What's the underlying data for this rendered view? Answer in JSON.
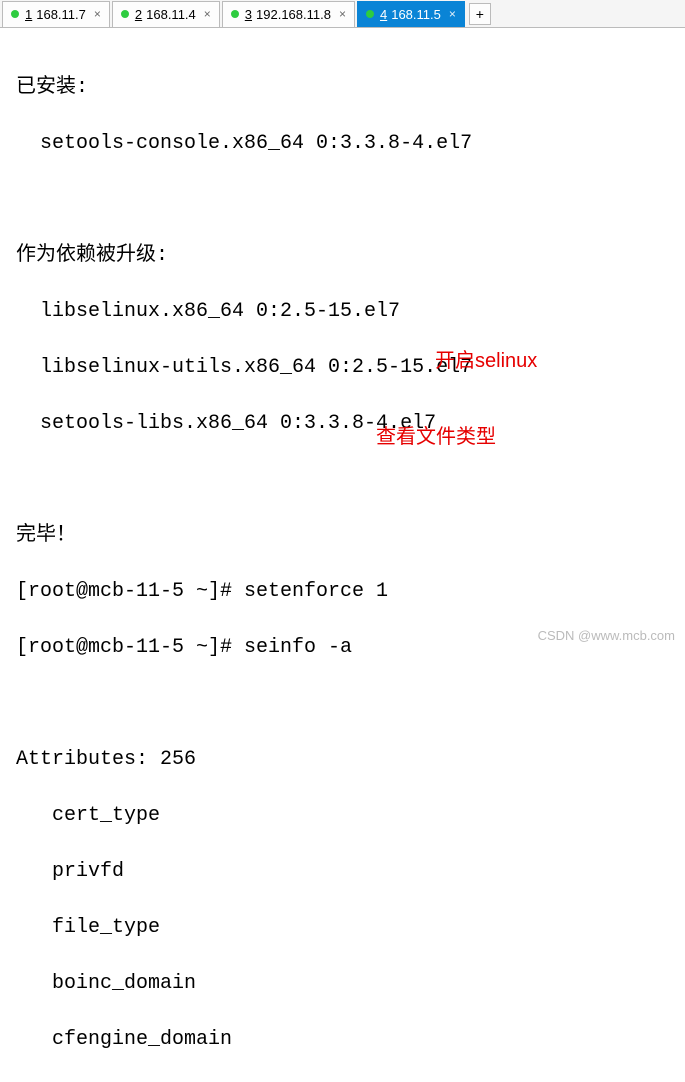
{
  "tabs": [
    {
      "num": "1",
      "label": "168.11.7",
      "active": false
    },
    {
      "num": "2",
      "label": "168.11.4",
      "active": false
    },
    {
      "num": "3",
      "label": "192.168.11.8",
      "active": false
    },
    {
      "num": "4",
      "label": "168.11.5",
      "active": true
    }
  ],
  "new_tab_glyph": "+",
  "close_glyph": "×",
  "terminal": {
    "installed_header": "已安装:",
    "installed_pkg": "  setools-console.x86_64 0:3.3.8-4.el7",
    "deps_header": "作为依赖被升级:",
    "dep1": "  libselinux.x86_64 0:2.5-15.el7",
    "dep2": "  libselinux-utils.x86_64 0:2.5-15.el7",
    "dep3": "  setools-libs.x86_64 0:3.3.8-4.el7",
    "done": "完毕！",
    "prompt1": "[root@mcb-11-5 ~]# setenforce 1",
    "prompt2": "[root@mcb-11-5 ~]# seinfo -a",
    "attr_header": "Attributes: 256",
    "attr1": "   cert_type",
    "attr2": "   privfd",
    "attr3": "   file_type",
    "attr4": "   boinc_domain",
    "attr5": "   cfengine_domain"
  },
  "annotations": {
    "a1": "开启selinux",
    "a2": "查看文件类型"
  },
  "watermark": "CSDN @www.mcb.com"
}
